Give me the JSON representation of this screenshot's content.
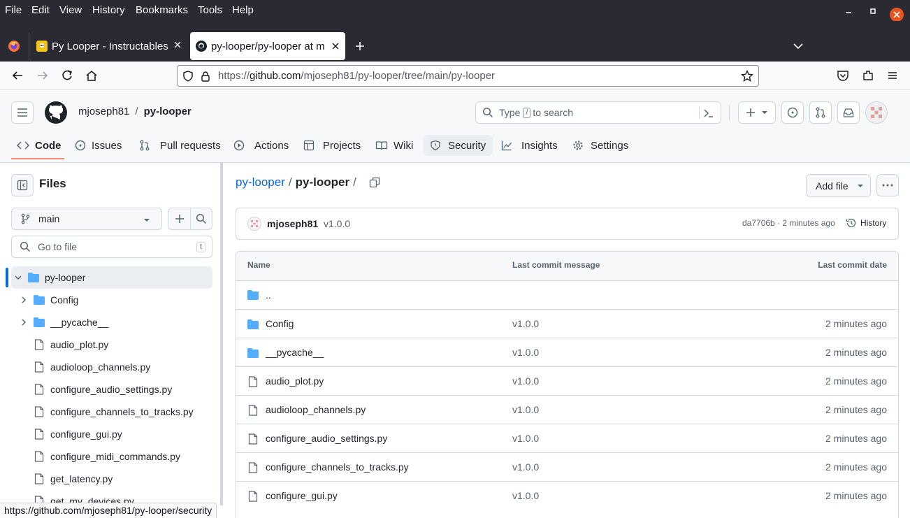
{
  "menubar": {
    "items": [
      "File",
      "Edit",
      "View",
      "History",
      "Bookmarks",
      "Tools",
      "Help"
    ],
    "underline": [
      "F",
      "E",
      "V",
      "s",
      "B",
      "T",
      "H"
    ]
  },
  "tabs": [
    {
      "title": "Py Looper - Instructables",
      "active": false
    },
    {
      "title": "py-looper/py-looper at m",
      "active": true
    }
  ],
  "url": {
    "prefix": "https://",
    "host": "github.com",
    "path": "/mjoseph81/py-looper/tree/main/py-looper"
  },
  "header": {
    "owner": "mjoseph81",
    "sep": "/",
    "repo": "py-looper",
    "search_pre": "Type",
    "search_key": "/",
    "search_post": "to search"
  },
  "repo_nav": [
    "Code",
    "Issues",
    "Pull requests",
    "Actions",
    "Projects",
    "Wiki",
    "Security",
    "Insights",
    "Settings"
  ],
  "sidebar": {
    "title": "Files",
    "branch": "main",
    "goto_placeholder": "Go to file",
    "goto_key": "t",
    "tree": [
      {
        "name": "py-looper",
        "type": "dir-open",
        "depth": 0
      },
      {
        "name": "Config",
        "type": "dir",
        "depth": 1
      },
      {
        "name": "__pycache__",
        "type": "dir",
        "depth": 1
      },
      {
        "name": "audio_plot.py",
        "type": "file",
        "depth": 1
      },
      {
        "name": "audioloop_channels.py",
        "type": "file",
        "depth": 1
      },
      {
        "name": "configure_audio_settings.py",
        "type": "file",
        "depth": 1
      },
      {
        "name": "configure_channels_to_tracks.py",
        "type": "file",
        "depth": 1
      },
      {
        "name": "configure_gui.py",
        "type": "file",
        "depth": 1
      },
      {
        "name": "configure_midi_commands.py",
        "type": "file",
        "depth": 1
      },
      {
        "name": "get_latency.py",
        "type": "file",
        "depth": 1
      },
      {
        "name": "get_my_devices.py",
        "type": "file",
        "depth": 1
      }
    ]
  },
  "breadcrumb": {
    "root": "py-looper",
    "sep": "/",
    "current": "py-looper",
    "trail": "/"
  },
  "add_file": "Add file",
  "commit": {
    "author": "mjoseph81",
    "message": "v1.0.0",
    "meta": "da7706b · 2 minutes ago",
    "history": "History"
  },
  "table": {
    "headers": {
      "name": "Name",
      "message": "Last commit message",
      "date": "Last commit date"
    },
    "parent": "..",
    "rows": [
      {
        "name": "Config",
        "type": "dir",
        "message": "v1.0.0",
        "date": "2 minutes ago"
      },
      {
        "name": "__pycache__",
        "type": "dir",
        "message": "v1.0.0",
        "date": "2 minutes ago"
      },
      {
        "name": "audio_plot.py",
        "type": "file",
        "message": "v1.0.0",
        "date": "2 minutes ago"
      },
      {
        "name": "audioloop_channels.py",
        "type": "file",
        "message": "v1.0.0",
        "date": "2 minutes ago"
      },
      {
        "name": "configure_audio_settings.py",
        "type": "file",
        "message": "v1.0.0",
        "date": "2 minutes ago"
      },
      {
        "name": "configure_channels_to_tracks.py",
        "type": "file",
        "message": "v1.0.0",
        "date": "2 minutes ago"
      },
      {
        "name": "configure_gui.py",
        "type": "file",
        "message": "v1.0.0",
        "date": "2 minutes ago"
      }
    ]
  },
  "status_url": "https://github.com/mjoseph81/py-looper/security",
  "colors": {
    "link": "#0969da",
    "folder": "#54aeff",
    "os_dark": "#2b2a33",
    "close_red": "#e95420"
  }
}
